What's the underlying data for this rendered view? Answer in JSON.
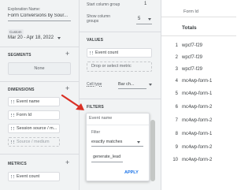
{
  "variables": {
    "exploration_name_label": "Exploration Name:",
    "exploration_name_value": "Form Conversions by Sour...",
    "custom_badge": "Custom",
    "date_range": "Mar 20 - Apr 18, 2022",
    "segments_title": "SEGMENTS",
    "segments_none": "None",
    "dimensions_title": "DIMENSIONS",
    "dimensions": [
      "Event name",
      "Form Id",
      "Session source / m...",
      "Source / medium"
    ],
    "metrics_title": "METRICS",
    "metrics": [
      "Event count"
    ]
  },
  "settings": {
    "start_column_group_label": "Start column group",
    "start_column_group_value": "1",
    "show_column_groups_label": "Show column groups",
    "show_column_groups_value": "5",
    "values_title": "VALUES",
    "values_chip": "Event count",
    "drop_placeholder": "Drop or select metric",
    "cell_type_label": "Cell type",
    "cell_type_value": "Bar ch...",
    "filters_title": "FILTERS",
    "filter": {
      "dimension": "Event name",
      "filter_label": "Filter",
      "match_type": "exactly matches",
      "expression": "generate_lead",
      "apply_label": "APPLY"
    }
  },
  "canvas": {
    "dimension_header": "Form Id",
    "totals_label": "Totals",
    "rows": [
      {
        "index": "1",
        "value": "wpcf7-f29"
      },
      {
        "index": "2",
        "value": "wpcf7-f29"
      },
      {
        "index": "3",
        "value": "wpcf7-f29"
      },
      {
        "index": "4",
        "value": "mc4wp-form-1"
      },
      {
        "index": "5",
        "value": "mc4wp-form-1"
      },
      {
        "index": "6",
        "value": "mc4wp-form-2"
      },
      {
        "index": "7",
        "value": "mc4wp-form-2"
      },
      {
        "index": "8",
        "value": "mc4wp-form-1"
      },
      {
        "index": "9",
        "value": "mc4wp-form-2"
      },
      {
        "index": "10",
        "value": "mc4wp-form-2"
      }
    ]
  },
  "colors": {
    "accent": "#1a73e8",
    "panel_bg": "#f1f3f4",
    "arrow": "#d93025"
  }
}
